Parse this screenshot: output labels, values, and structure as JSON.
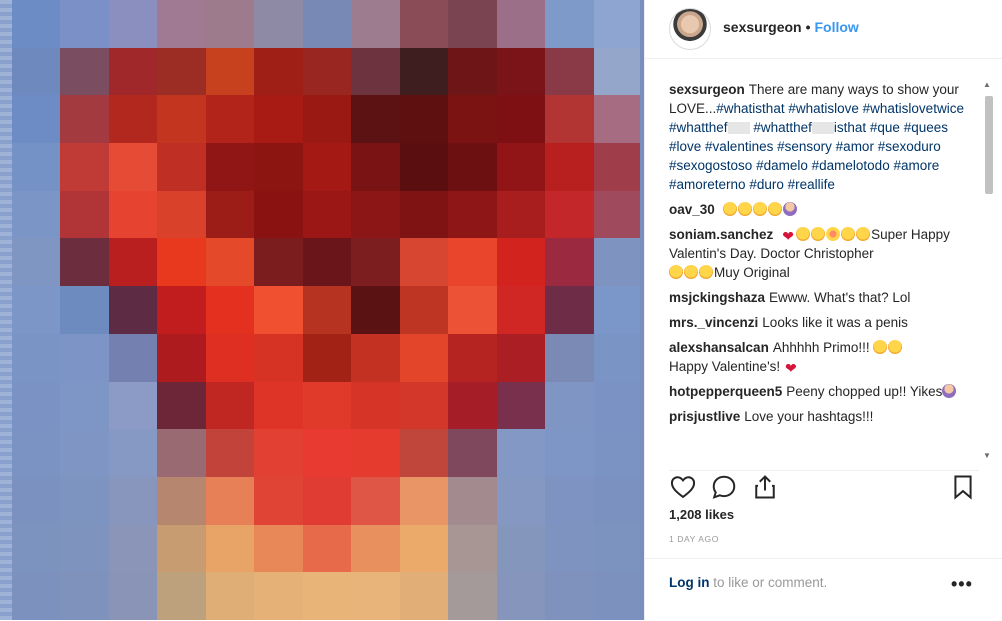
{
  "post": {
    "username": "sexsurgeon",
    "separator": "•",
    "follow_label": "Follow"
  },
  "caption": {
    "username": "sexsurgeon",
    "text_before_tags": "There are many ways to show your LOVE...",
    "tags": [
      "#whatisthat",
      "#whatislove",
      "#whatislovetwice",
      "#whatthef",
      "#whatthef",
      "isthat",
      "#que",
      "#quees",
      "#love",
      "#valentines",
      "#sensory",
      "#amor",
      "#sexoduro",
      "#sexogostoso",
      "#damelo",
      "#damelotodo",
      "#amore",
      "#amoreterno",
      "#duro",
      "#reallife"
    ]
  },
  "comments": [
    {
      "user": "oav_30",
      "text": ""
    },
    {
      "user": "soniam.sanchez",
      "text": "Super Happy Valentin's Day. Doctor Christopher",
      "text2": "Muy Original"
    },
    {
      "user": "msjckingshaza",
      "text": "Ewww. What's that? Lol"
    },
    {
      "user": "mrs._vincenzi",
      "text": "Looks like it was a penis"
    },
    {
      "user": "alexshansalcan",
      "text": "Ahhhhh Primo!!!",
      "text2": "Happy Valentine's!"
    },
    {
      "user": "hotpepperqueen5",
      "text": "Peeny chopped up!! Yikes"
    },
    {
      "user": "prisjustlive",
      "text": "Love your hashtags!!!"
    }
  ],
  "icons": [
    "heart-icon",
    "comment-icon",
    "share-icon",
    "bookmark-icon",
    "more-icon"
  ],
  "likes": "1,208 likes",
  "timestamp": "1 DAY AGO",
  "login": {
    "link": "Log in",
    "text": " to like or comment."
  },
  "image": {
    "description_style": "pixelated",
    "colors": [
      [
        "#6b8cc4",
        "#7a90c6",
        "#8b8fbf",
        "#a07a93",
        "#9d7a8c",
        "#8e8aa6",
        "#7889b6",
        "#9d7c8f",
        "#8a4d58",
        "#7a4550",
        "#9b6f88",
        "#7e9ac9",
        "#8ea5d1"
      ],
      [
        "#6e89bd",
        "#7b4d60",
        "#a0282a",
        "#9c2d24",
        "#c7411f",
        "#9f1f17",
        "#9a2622",
        "#6d3440",
        "#3e1e1e",
        "#6e1518",
        "#7a1418",
        "#8a3a46",
        "#95a6cb"
      ],
      [
        "#6d8bc4",
        "#a33a40",
        "#b2281e",
        "#c4351f",
        "#b22419",
        "#a81b15",
        "#9a1913",
        "#5c1212",
        "#5e0f10",
        "#7c1313",
        "#7e1014",
        "#b23433",
        "#a66d82"
      ],
      [
        "#7592c6",
        "#c03a36",
        "#e64b35",
        "#bf2f23",
        "#8f1614",
        "#8c1512",
        "#a41914",
        "#7a1313",
        "#5a0e0f",
        "#6d1012",
        "#911517",
        "#b81f1f",
        "#9f3d4a"
      ],
      [
        "#7b96c6",
        "#b13436",
        "#e74331",
        "#d9412b",
        "#9c1c17",
        "#8a1312",
        "#9a1716",
        "#8c1616",
        "#7f1313",
        "#8f1616",
        "#a81d1d",
        "#c4272a",
        "#a04a5d"
      ],
      [
        "#7f95c2",
        "#6c2d3f",
        "#ba1f1f",
        "#e8391f",
        "#e44a2a",
        "#7b1d1f",
        "#6a1519",
        "#7c1e1f",
        "#d64630",
        "#e8452c",
        "#d3231f",
        "#9b2a40",
        "#7f93c0"
      ],
      [
        "#7d96c8",
        "#6d8bbf",
        "#5d2b44",
        "#c21d1e",
        "#e3301f",
        "#f0502f",
        "#b63322",
        "#5a1212",
        "#bf3524",
        "#ec5236",
        "#d02724",
        "#6e2c46",
        "#7b96c8"
      ],
      [
        "#7a94c6",
        "#7d95c6",
        "#7480b0",
        "#ad1b1e",
        "#df2e22",
        "#d73324",
        "#a32216",
        "#c23121",
        "#e3452b",
        "#b52421",
        "#aa1e24",
        "#7a8ab5",
        "#7a94c6"
      ],
      [
        "#7a93c4",
        "#7e96c6",
        "#8b9bc6",
        "#6d2538",
        "#c12722",
        "#dd3427",
        "#e03a2a",
        "#d63426",
        "#d2372a",
        "#a51e27",
        "#78304c",
        "#7f96c5",
        "#7a93c4"
      ],
      [
        "#7a93c3",
        "#7f96c4",
        "#8698c4",
        "#9a6a72",
        "#c2433a",
        "#e24032",
        "#e83a30",
        "#e43b2e",
        "#c0453b",
        "#80485c",
        "#8398c4",
        "#7e96c5",
        "#7a93c3"
      ],
      [
        "#7b92c1",
        "#7d93c0",
        "#8896bd",
        "#b7866f",
        "#e88057",
        "#df4435",
        "#e03c33",
        "#df5646",
        "#e99566",
        "#a38a8f",
        "#8598c1",
        "#7e93c1",
        "#7b92c1"
      ],
      [
        "#7c92bf",
        "#7e93be",
        "#8b95b8",
        "#c79c71",
        "#e8a467",
        "#e88858",
        "#e76a4b",
        "#e9905f",
        "#eba96a",
        "#a79694",
        "#8596bd",
        "#7e93bf",
        "#7c92bf"
      ],
      [
        "#7c91bd",
        "#7e92bc",
        "#8a94b6",
        "#bda07c",
        "#dfae76",
        "#e6b176",
        "#e8b478",
        "#e9b47a",
        "#e2ae78",
        "#a59a9a",
        "#8595bb",
        "#7e92bd",
        "#7c91bd"
      ]
    ]
  }
}
